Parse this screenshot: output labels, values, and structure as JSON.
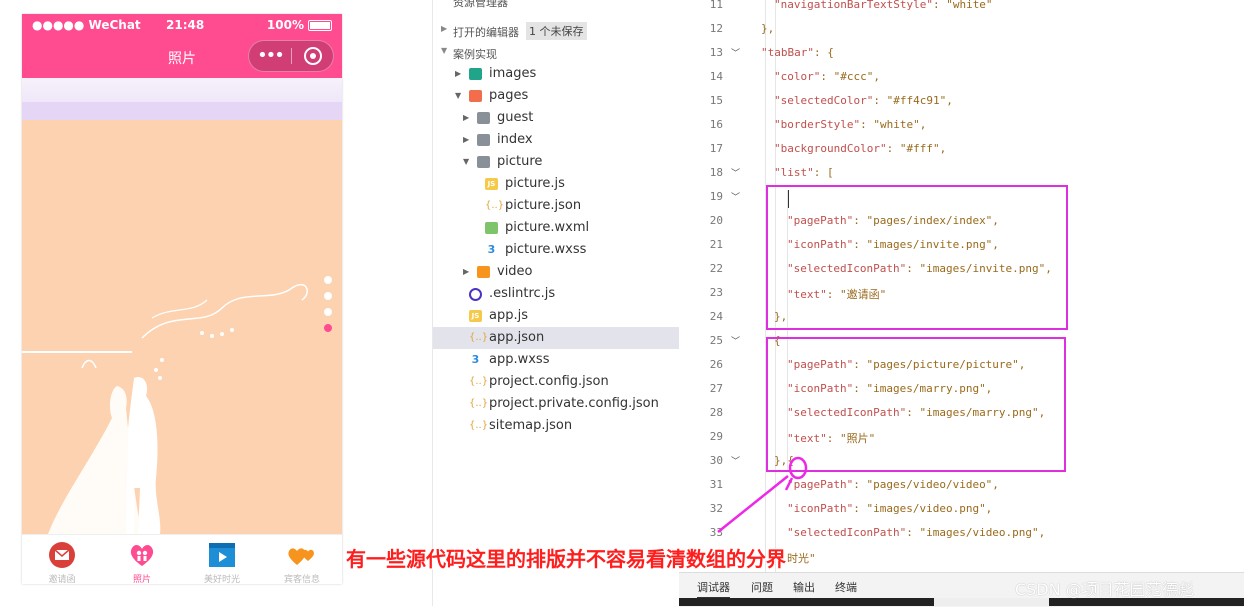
{
  "phone": {
    "signal": "●●●●● WeChat",
    "time": "21:48",
    "battery": "100%",
    "nav_title": "照片",
    "capsule_dots": "•••",
    "tabs": [
      {
        "label": "邀请函",
        "icon": "envelope-icon",
        "color": "#d9403a"
      },
      {
        "label": "照片",
        "icon": "couple-heart-icon",
        "color": "#ff4c91"
      },
      {
        "label": "美好时光",
        "icon": "video-play-icon",
        "color": "#1e8fd6"
      },
      {
        "label": "宾客信息",
        "icon": "hearts-icon",
        "color": "#f7941d"
      }
    ],
    "selected_tab_color": "#ff4c91",
    "swiper_total": 4,
    "swiper_active": 4
  },
  "explorer": {
    "header": "资源管理器",
    "open_editors": "打开的编辑器",
    "unsaved": "1 个未保存",
    "project": "案例实现",
    "tree": [
      {
        "name": "images",
        "depth": 1,
        "twisty": "▸",
        "icon": "img"
      },
      {
        "name": "pages",
        "depth": 1,
        "twisty": "▾",
        "icon": "pages"
      },
      {
        "name": "guest",
        "depth": 2,
        "twisty": "▸",
        "icon": "folder"
      },
      {
        "name": "index",
        "depth": 2,
        "twisty": "▸",
        "icon": "folder"
      },
      {
        "name": "picture",
        "depth": 2,
        "twisty": "▾",
        "icon": "folder"
      },
      {
        "name": "picture.js",
        "depth": 3,
        "twisty": "",
        "icon": "js"
      },
      {
        "name": "picture.json",
        "depth": 3,
        "twisty": "",
        "icon": "json"
      },
      {
        "name": "picture.wxml",
        "depth": 3,
        "twisty": "",
        "icon": "wxml"
      },
      {
        "name": "picture.wxss",
        "depth": 3,
        "twisty": "",
        "icon": "wxss"
      },
      {
        "name": "video",
        "depth": 2,
        "twisty": "▸",
        "icon": "video"
      },
      {
        "name": ".eslintrc.js",
        "depth": 1,
        "twisty": "",
        "icon": "eslint"
      },
      {
        "name": "app.js",
        "depth": 1,
        "twisty": "",
        "icon": "js"
      },
      {
        "name": "app.json",
        "depth": 1,
        "twisty": "",
        "icon": "json",
        "active": true
      },
      {
        "name": "app.wxss",
        "depth": 1,
        "twisty": "",
        "icon": "wxss"
      },
      {
        "name": "project.config.json",
        "depth": 1,
        "twisty": "",
        "icon": "json"
      },
      {
        "name": "project.private.config.json",
        "depth": 1,
        "twisty": "",
        "icon": "json"
      },
      {
        "name": "sitemap.json",
        "depth": 1,
        "twisty": "",
        "icon": "json"
      }
    ]
  },
  "editor": {
    "lines": [
      {
        "n": "11",
        "indent": 1,
        "key": "\"navigationBarTextStyle\"",
        "rest": ": \"white\""
      },
      {
        "n": "12",
        "indent": 0,
        "key": "",
        "rest": "},"
      },
      {
        "n": "13",
        "indent": 0,
        "key": "\"tabBar\"",
        "rest": ": {",
        "fold": true
      },
      {
        "n": "14",
        "indent": 1,
        "key": "\"color\"",
        "rest": ": \"#ccc\","
      },
      {
        "n": "15",
        "indent": 1,
        "key": "\"selectedColor\"",
        "rest": ": \"#ff4c91\","
      },
      {
        "n": "16",
        "indent": 1,
        "key": "\"borderStyle\"",
        "rest": ": \"white\","
      },
      {
        "n": "17",
        "indent": 1,
        "key": "\"backgroundColor\"",
        "rest": ": \"#fff\","
      },
      {
        "n": "18",
        "indent": 1,
        "key": "\"list\"",
        "rest": ": [",
        "fold": true
      },
      {
        "n": "19",
        "indent": 2,
        "key": "",
        "rest": "",
        "fold": true
      },
      {
        "n": "20",
        "indent": 2,
        "key": "\"pagePath\"",
        "rest": ": \"pages/index/index\","
      },
      {
        "n": "21",
        "indent": 2,
        "key": "\"iconPath\"",
        "rest": ": \"images/invite.png\","
      },
      {
        "n": "22",
        "indent": 2,
        "key": "\"selectedIconPath\"",
        "rest": ": \"images/invite.png\","
      },
      {
        "n": "23",
        "indent": 2,
        "key": "\"text\"",
        "rest": ": \"邀请函\""
      },
      {
        "n": "24",
        "indent": 1,
        "key": "",
        "rest": "},"
      },
      {
        "n": "25",
        "indent": 1,
        "key": "",
        "rest": "{",
        "fold": true
      },
      {
        "n": "26",
        "indent": 2,
        "key": "\"pagePath\"",
        "rest": ": \"pages/picture/picture\","
      },
      {
        "n": "27",
        "indent": 2,
        "key": "\"iconPath\"",
        "rest": ": \"images/marry.png\","
      },
      {
        "n": "28",
        "indent": 2,
        "key": "\"selectedIconPath\"",
        "rest": ": \"images/marry.png\","
      },
      {
        "n": "29",
        "indent": 2,
        "key": "\"text\"",
        "rest": ": \"照片\""
      },
      {
        "n": "30",
        "indent": 1,
        "key": "",
        "rest": "},{",
        "fold": true
      },
      {
        "n": "31",
        "indent": 2,
        "key": "\"pagePath\"",
        "rest": ": \"pages/video/video\","
      },
      {
        "n": "32",
        "indent": 2,
        "key": "\"iconPath\"",
        "rest": ": \"images/video.png\","
      },
      {
        "n": "33",
        "indent": 2,
        "key": "\"selectedIconPath\"",
        "rest": ": \"images/video.png\","
      },
      {
        "n": "34",
        "indent": 2,
        "key": "",
        "rest": "时光\""
      }
    ],
    "highlight_color": "#dd2ee0"
  },
  "bottom_tabs": [
    "调试器",
    "问题",
    "输出",
    "终端"
  ],
  "annotation": "有一些源代码这里的排版并不容易看清数组的分界",
  "watermark": "CSDN @项目花园范德彪"
}
